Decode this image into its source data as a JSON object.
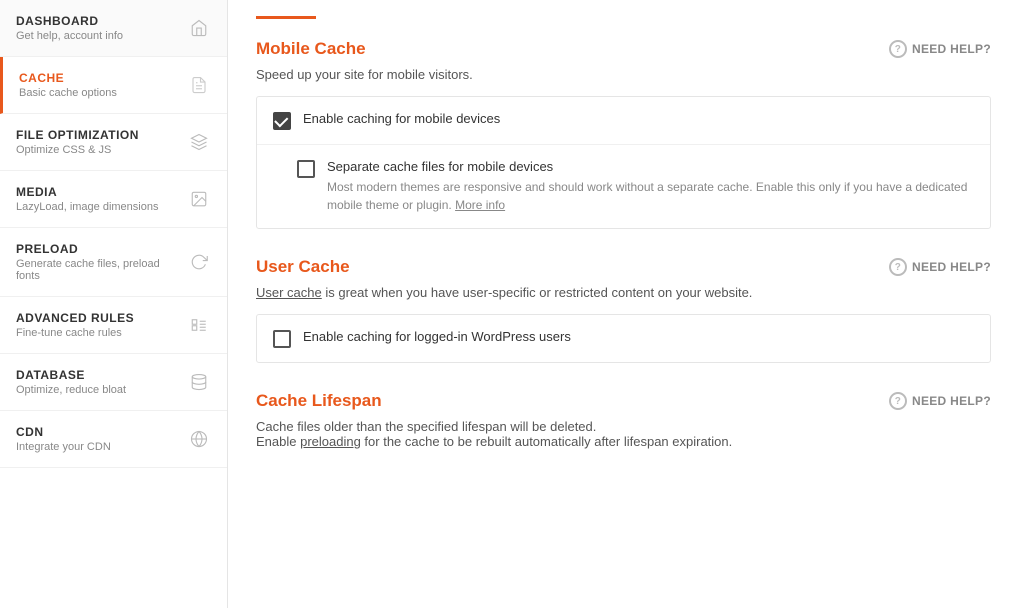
{
  "sidebar": {
    "items": [
      {
        "id": "dashboard",
        "title": "DASHBOARD",
        "subtitle": "Get help, account info",
        "icon": "home",
        "active": false
      },
      {
        "id": "cache",
        "title": "CACHE",
        "subtitle": "Basic cache options",
        "icon": "file",
        "active": true
      },
      {
        "id": "file-optimization",
        "title": "FILE OPTIMIZATION",
        "subtitle": "Optimize CSS & JS",
        "icon": "layers",
        "active": false
      },
      {
        "id": "media",
        "title": "MEDIA",
        "subtitle": "LazyLoad, image dimensions",
        "icon": "image",
        "active": false
      },
      {
        "id": "preload",
        "title": "PRELOAD",
        "subtitle": "Generate cache files, preload fonts",
        "icon": "refresh",
        "active": false
      },
      {
        "id": "advanced-rules",
        "title": "ADVANCED RULES",
        "subtitle": "Fine-tune cache rules",
        "icon": "list",
        "active": false
      },
      {
        "id": "database",
        "title": "DATABASE",
        "subtitle": "Optimize, reduce bloat",
        "icon": "database",
        "active": false
      },
      {
        "id": "cdn",
        "title": "CDN",
        "subtitle": "Integrate your CDN",
        "icon": "globe",
        "active": false
      }
    ]
  },
  "main": {
    "sections": [
      {
        "id": "mobile-cache",
        "title": "Mobile Cache",
        "need_help": "NEED HELP?",
        "description": "Speed up your site for mobile visitors.",
        "options": [
          {
            "id": "enable-mobile-cache",
            "label": "Enable caching for mobile devices",
            "checked": true,
            "indented": false,
            "sublabel": ""
          },
          {
            "id": "separate-mobile-cache",
            "label": "Separate cache files for mobile devices",
            "checked": false,
            "indented": true,
            "sublabel": "Most modern themes are responsive and should work without a separate cache. Enable this only if you have a dedicated mobile theme or plugin.",
            "sublabel_link": "More info"
          }
        ]
      },
      {
        "id": "user-cache",
        "title": "User Cache",
        "need_help": "NEED HELP?",
        "description_parts": [
          {
            "type": "link",
            "text": "User cache"
          },
          {
            "type": "text",
            "text": " is great when you have user-specific or restricted content on your website."
          }
        ],
        "description": "User cache is great when you have user-specific or restricted content on your website.",
        "options": [
          {
            "id": "enable-logged-in-cache",
            "label": "Enable caching for logged-in WordPress users",
            "checked": false,
            "indented": false,
            "sublabel": ""
          }
        ]
      },
      {
        "id": "cache-lifespan",
        "title": "Cache Lifespan",
        "need_help": "NEED HELP?",
        "description_line1": "Cache files older than the specified lifespan will be deleted.",
        "description_line2_prefix": "Enable ",
        "description_line2_link": "preloading",
        "description_line2_suffix": " for the cache to be rebuilt automatically after lifespan expiration.",
        "options": []
      }
    ]
  }
}
